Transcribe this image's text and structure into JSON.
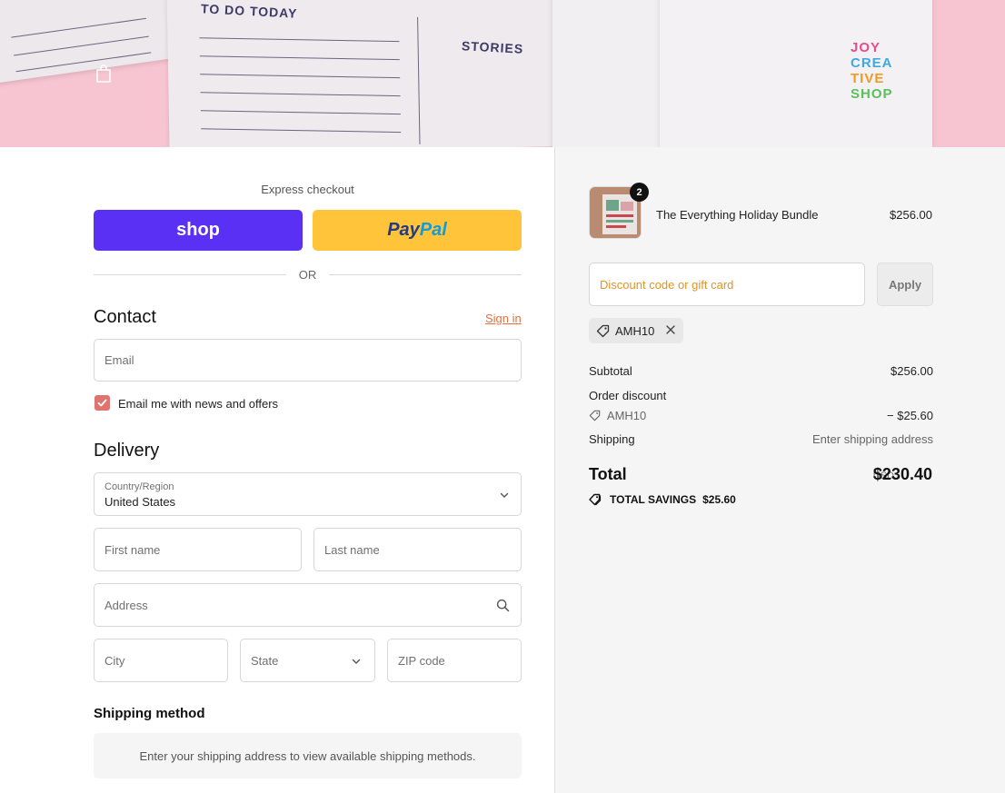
{
  "banner": {
    "todo_text": "TO DO TODAY",
    "stories_text": "STORIES",
    "logo_lines": [
      "JOY",
      "CREA",
      "TIVE",
      "SHOP"
    ]
  },
  "express": {
    "label": "Express checkout",
    "shop_label": "shop",
    "paypal_part1": "Pay",
    "paypal_part2": "Pal",
    "or_label": "OR"
  },
  "contact": {
    "heading": "Contact",
    "sign_in": "Sign in",
    "email_placeholder": "Email",
    "newsletter_label": "Email me with news and offers",
    "newsletter_checked": true
  },
  "delivery": {
    "heading": "Delivery",
    "country_label": "Country/Region",
    "country_value": "United States",
    "first_name_placeholder": "First name",
    "last_name_placeholder": "Last name",
    "address_placeholder": "Address",
    "city_placeholder": "City",
    "state_label": "State",
    "zip_placeholder": "ZIP code"
  },
  "shipping_method": {
    "heading": "Shipping method",
    "message": "Enter your shipping address to view available shipping methods."
  },
  "order": {
    "quantity": "2",
    "product_name": "The Everything Holiday Bundle",
    "product_price": "$256.00",
    "discount_placeholder": "Discount code or gift card",
    "apply_label": "Apply",
    "applied_code": "AMH10",
    "subtotal_label": "Subtotal",
    "subtotal_value": "$256.00",
    "order_discount_label": "Order discount",
    "discount_code": "AMH10",
    "discount_value": "− $25.60",
    "shipping_label": "Shipping",
    "shipping_value": "Enter shipping address",
    "total_label": "Total",
    "currency": "USD",
    "total_value": "$230.40",
    "savings_label": "TOTAL SAVINGS",
    "savings_value": "$25.60"
  },
  "colors": {
    "shop_purple": "#5a31f4",
    "paypal_yellow": "#ffc439",
    "accent_orange": "#e0703f",
    "checkbox": "#e0736d"
  }
}
